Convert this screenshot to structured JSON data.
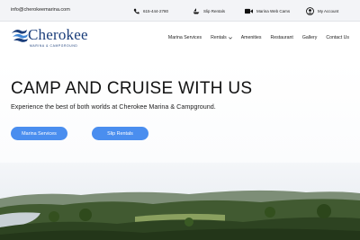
{
  "topbar": {
    "email": "info@cherokeemarina.com",
    "phone": "615-444-2780",
    "slip_rentals": "Slip Rentals",
    "web_cams": "Marina Web Cams",
    "account": "My Account",
    "icons": {
      "phone": "phone-icon",
      "slip": "boat-icon",
      "cam": "video-camera-icon",
      "account": "user-circle-icon"
    }
  },
  "logo": {
    "name": "Cherokee",
    "tagline": "MARINA & CAMPGROUND"
  },
  "nav": {
    "items": [
      "Marina Services",
      "Rentals",
      "Amenities",
      "Restaurant",
      "Gallery",
      "Contact Us"
    ]
  },
  "hero": {
    "headline": "CAMP AND CRUISE WITH US",
    "subheadline": "Experience the best of both worlds at Cherokee Marina & Campground.",
    "button_primary": "Marina Services",
    "button_secondary": "Slip Rentals"
  },
  "colors": {
    "accent": "#4a8eef",
    "brand": "#1a3d7a",
    "topbar_bg": "#f3f4f7"
  }
}
